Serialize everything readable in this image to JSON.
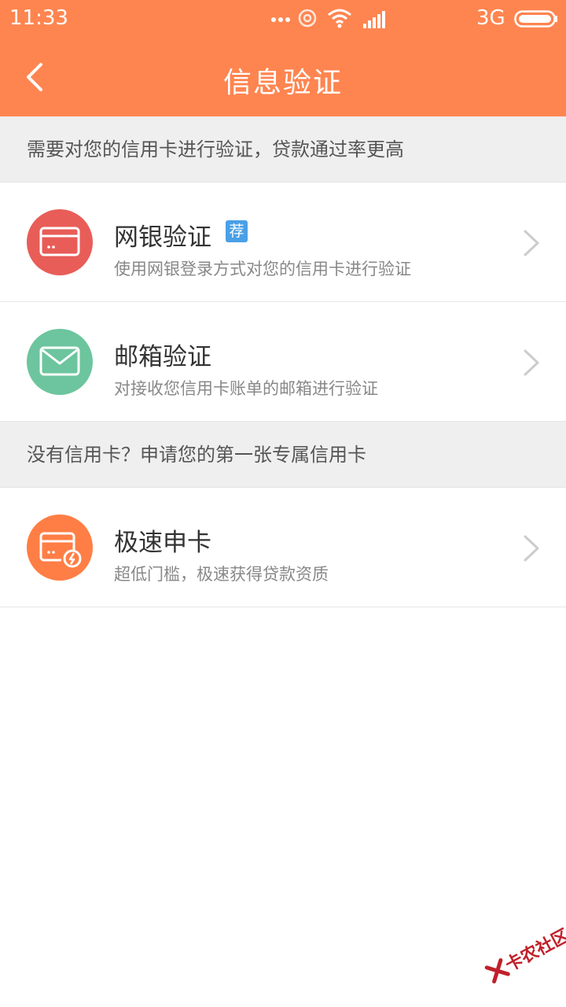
{
  "status_bar": {
    "time": "11:33",
    "network": "3G"
  },
  "nav": {
    "title": "信息验证"
  },
  "section1": {
    "header": "需要对您的信用卡进行验证，贷款通过率更高",
    "items": [
      {
        "name": "网银验证",
        "badge": "荐",
        "desc": "使用网银登录方式对您的信用卡进行验证",
        "icon": "card-icon",
        "color": "#E85D58"
      },
      {
        "name": "邮箱验证",
        "desc": "对接收您信用卡账单的邮箱进行验证",
        "icon": "mail-icon",
        "color": "#6CC59E"
      }
    ]
  },
  "section2": {
    "header": "没有信用卡？申请您的第一张专属信用卡",
    "items": [
      {
        "name": "极速申卡",
        "desc": "超低门槛，极速获得贷款资质",
        "icon": "card-flash-icon",
        "color": "#FF7E45"
      }
    ]
  },
  "watermark": {
    "text": "卡农社区"
  },
  "colors": {
    "accent": "#FF8550",
    "badge": "#4AA0E6"
  }
}
